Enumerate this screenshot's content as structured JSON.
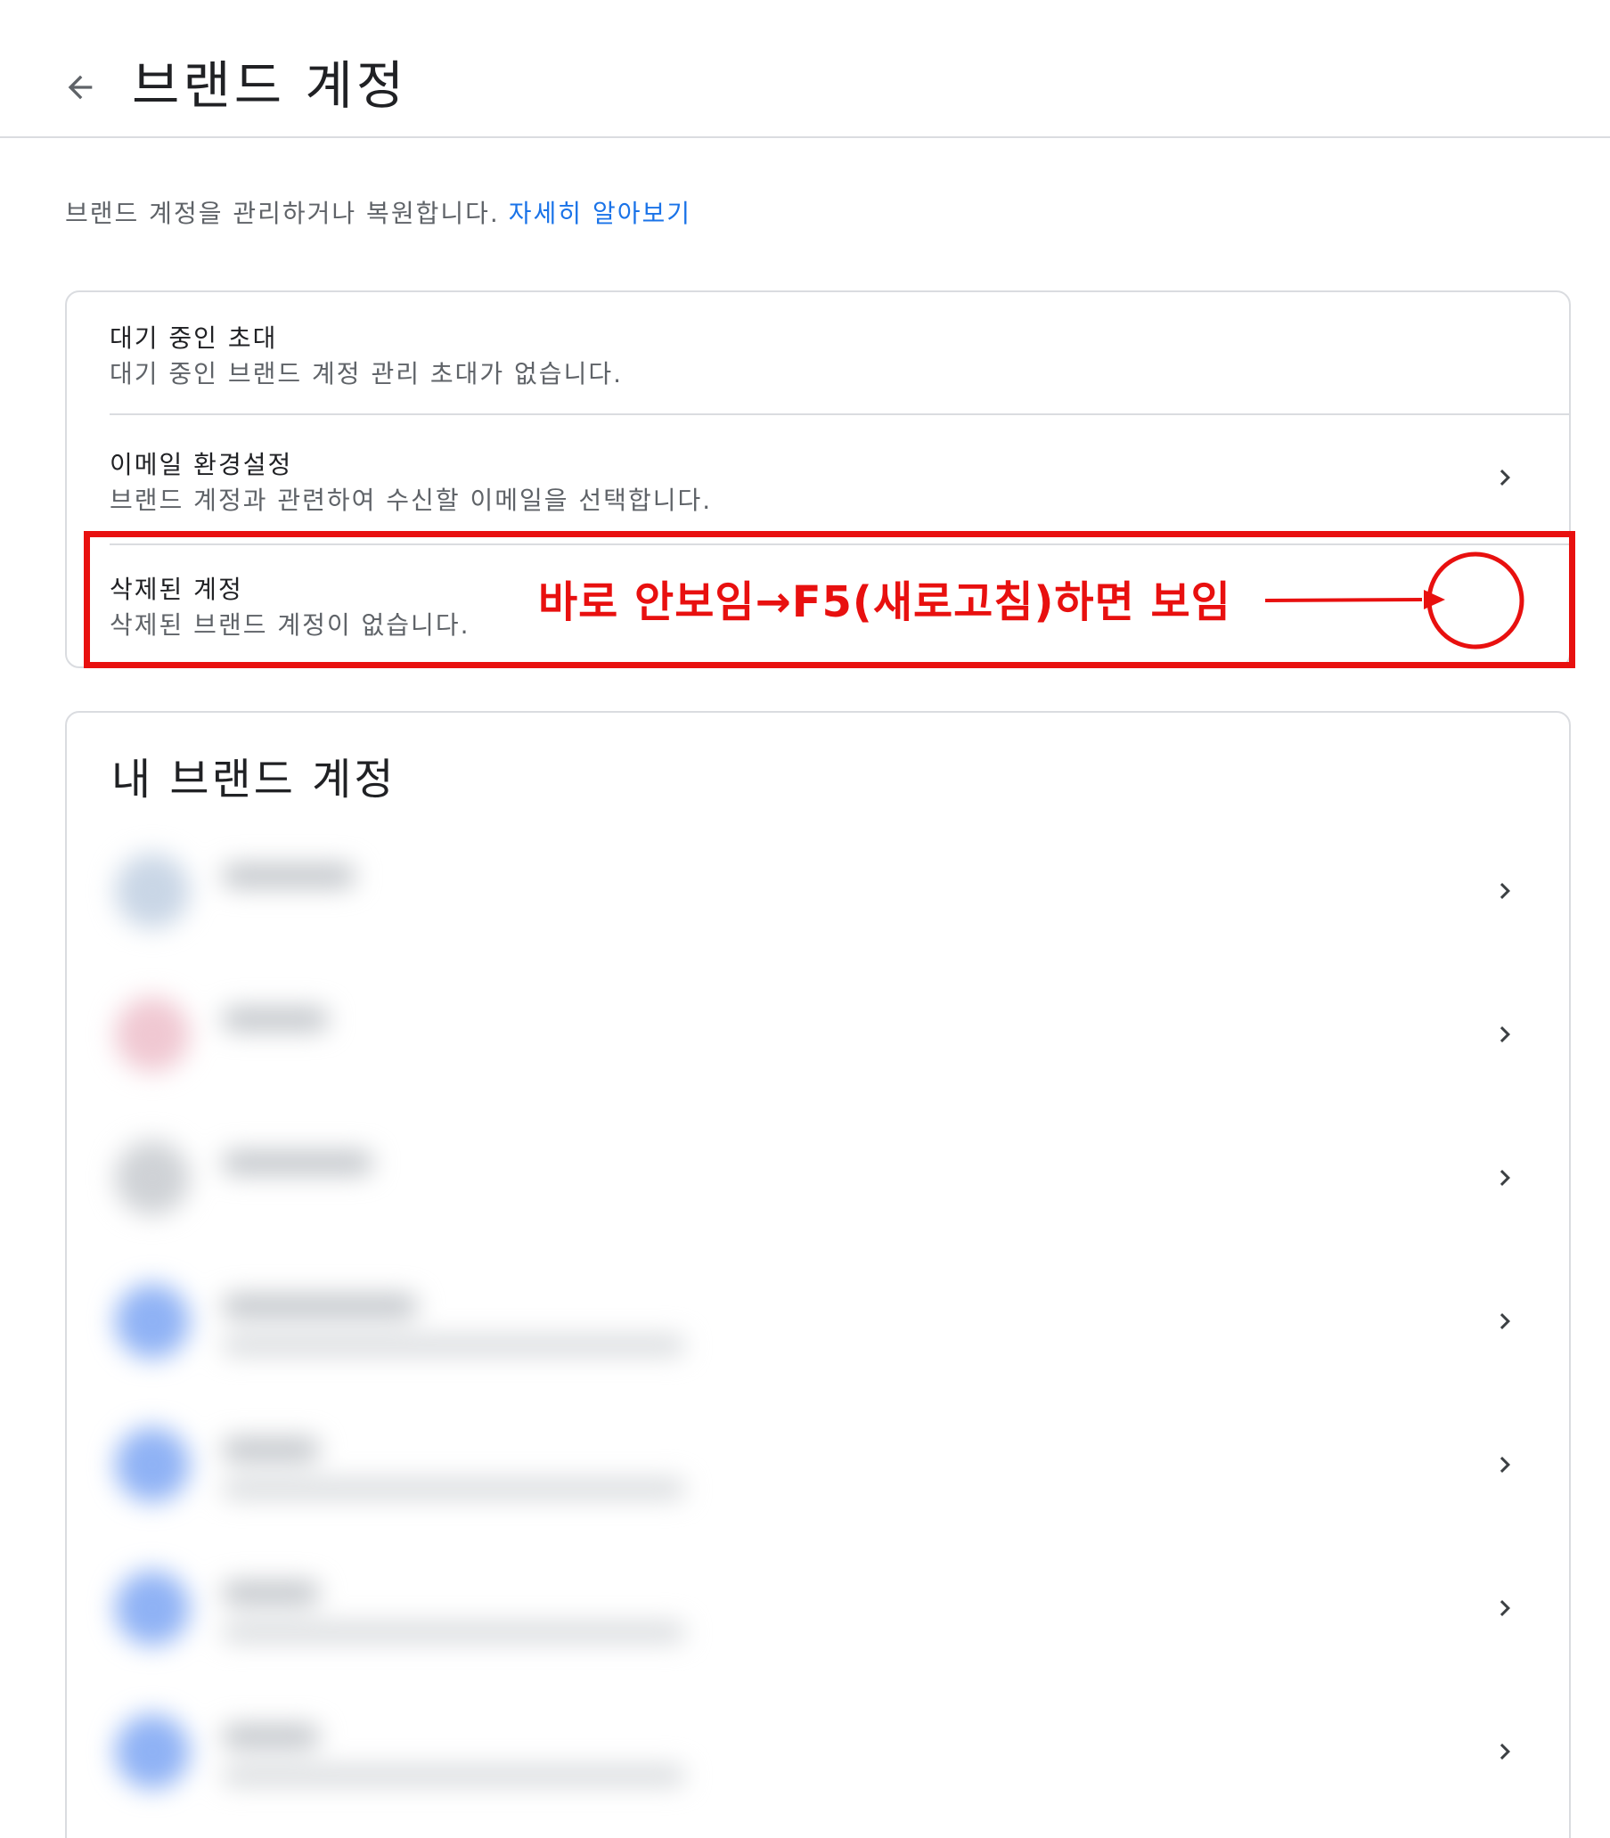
{
  "header": {
    "title": "브랜드 계정",
    "back_icon": "arrow-left-icon"
  },
  "intro": {
    "text": "브랜드 계정을 관리하거나 복원합니다.",
    "link": "자세히 알아보기"
  },
  "settings": {
    "pending": {
      "title": "대기 중인 초대",
      "subtitle": "대기 중인 브랜드 계정 관리 초대가 없습니다."
    },
    "email": {
      "title": "이메일 환경설정",
      "subtitle": "브랜드 계정과 관련하여 수신할 이메일을 선택합니다."
    },
    "deleted": {
      "title": "삭제된 계정",
      "subtitle": "삭제된 브랜드 계정이 없습니다."
    }
  },
  "annotation": {
    "text": "바로 안보임→F5(새로고침)하면 보임",
    "color": "#e8100f"
  },
  "brands": {
    "heading": "내 브랜드 계정",
    "items": [
      {
        "avatar_color": "#c9d6e6"
      },
      {
        "avatar_color": "#f0c8d2"
      },
      {
        "avatar_color": "#cfd2d6"
      },
      {
        "avatar_color": "#8fb2f5"
      },
      {
        "avatar_color": "#8fb2f5"
      },
      {
        "avatar_color": "#8fb2f5"
      },
      {
        "avatar_color": "#8fb2f5"
      }
    ]
  },
  "colors": {
    "link": "#1a73e8",
    "divider": "#dadce0",
    "text_primary": "#202124",
    "text_secondary": "#5f6368"
  }
}
